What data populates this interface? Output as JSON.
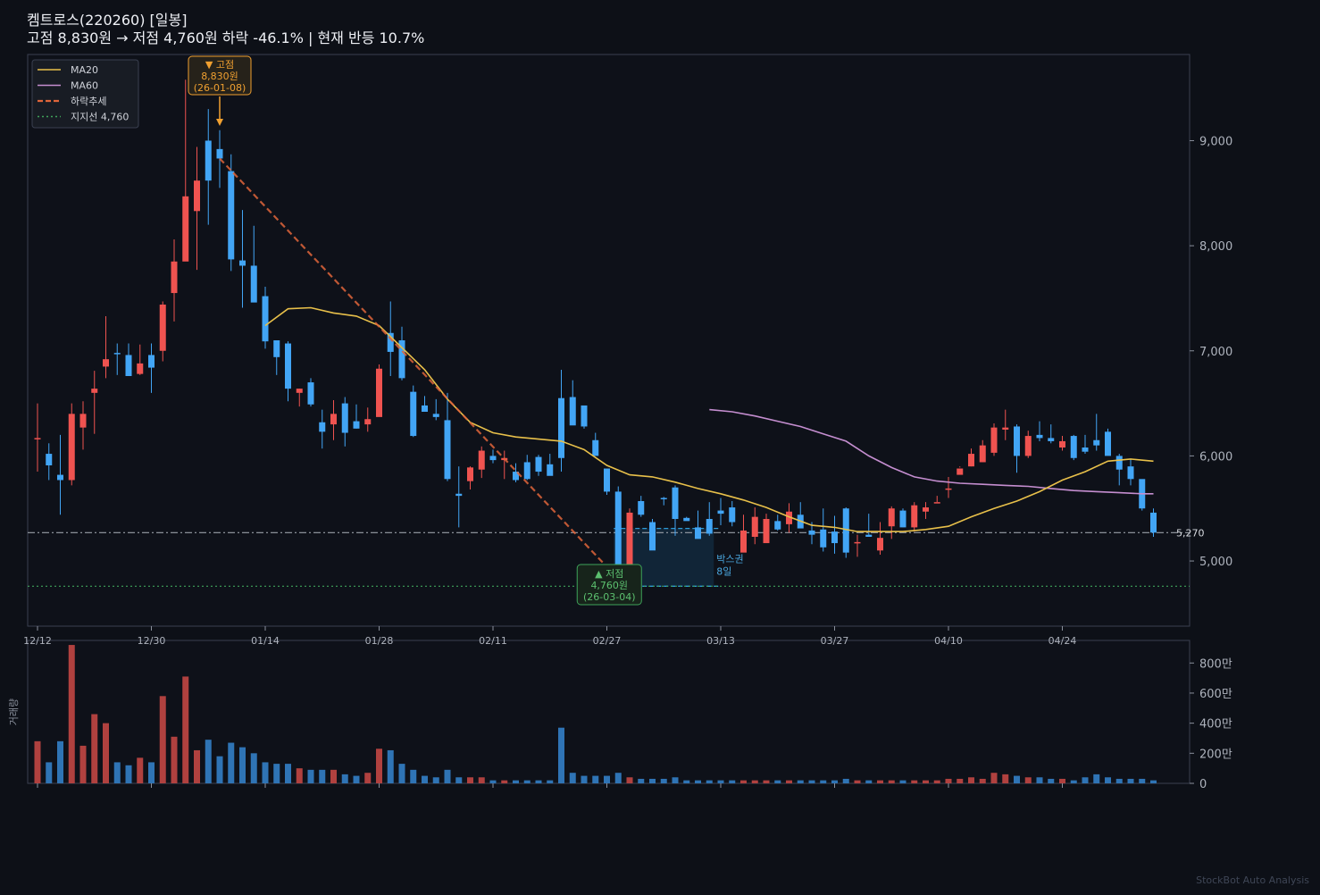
{
  "chart_data": {
    "type": "candlestick",
    "title": "켐트로스(220260)  [일봉]",
    "subtitle": "고점 8,830원 → 저점 4,760원  하락 -46.1%  |  현재 반등 10.7%",
    "x_ticks": [
      "12/12",
      "12/30",
      "01/14",
      "01/28",
      "02/11",
      "02/27",
      "03/13",
      "03/27",
      "04/10",
      "04/24"
    ],
    "price_ticks": [
      "5,000",
      "6,000",
      "7,000",
      "8,000",
      "9,000"
    ],
    "price_tick_values": [
      5000,
      6000,
      7000,
      8000,
      9000
    ],
    "volume_ticks": [
      "0",
      "200만",
      "400만",
      "600만",
      "800만"
    ],
    "volume_tick_values": [
      0,
      200,
      400,
      600,
      800
    ],
    "ylabel_volume": "거래량",
    "price_range": [
      4380,
      9820
    ],
    "volume_range": [
      0,
      950
    ],
    "legend": {
      "placement": "top-left",
      "items": [
        {
          "label": "MA20",
          "color": "#e8c04a",
          "style": "solid"
        },
        {
          "label": "MA60",
          "color": "#c58ed0",
          "style": "solid"
        },
        {
          "label": "하락추세",
          "color": "#e0653a",
          "style": "dashed"
        },
        {
          "label": "지지선 4,760",
          "color": "#3fa35a",
          "style": "dotted"
        }
      ]
    },
    "candles": [
      [
        6170,
        6500,
        5850,
        6170,
        280
      ],
      [
        6020,
        6120,
        5770,
        5910,
        140
      ],
      [
        5820,
        6200,
        5440,
        5770,
        280
      ],
      [
        5770,
        6500,
        5720,
        6400,
        920
      ],
      [
        6270,
        6520,
        6060,
        6400,
        250
      ],
      [
        6600,
        6810,
        6210,
        6640,
        460
      ],
      [
        6850,
        7330,
        6740,
        6920,
        400
      ],
      [
        6980,
        7070,
        6770,
        6970,
        140
      ],
      [
        6960,
        7070,
        6770,
        6760,
        120
      ],
      [
        6780,
        7060,
        6770,
        6880,
        170
      ],
      [
        6960,
        7070,
        6600,
        6840,
        140
      ],
      [
        7000,
        7470,
        6900,
        7440,
        580
      ],
      [
        7550,
        8060,
        7280,
        7850,
        310
      ],
      [
        7850,
        9580,
        8140,
        8470,
        710
      ],
      [
        8330,
        8940,
        7770,
        8620,
        220
      ],
      [
        9000,
        9300,
        8200,
        8620,
        290
      ],
      [
        8920,
        9100,
        8550,
        8830,
        180
      ],
      [
        8710,
        8870,
        7760,
        7870,
        270
      ],
      [
        7860,
        8340,
        7410,
        7810,
        240
      ],
      [
        7810,
        8190,
        7480,
        7460,
        200
      ],
      [
        7520,
        7610,
        7020,
        7090,
        140
      ],
      [
        7100,
        7090,
        6770,
        6940,
        130
      ],
      [
        7070,
        7090,
        6520,
        6640,
        130
      ],
      [
        6600,
        6640,
        6470,
        6640,
        100
      ],
      [
        6700,
        6740,
        6470,
        6490,
        90
      ],
      [
        6320,
        6440,
        6070,
        6230,
        90
      ],
      [
        6300,
        6530,
        6150,
        6400,
        90
      ],
      [
        6500,
        6560,
        6090,
        6220,
        60
      ],
      [
        6330,
        6490,
        6260,
        6260,
        50
      ],
      [
        6300,
        6460,
        6230,
        6350,
        70
      ],
      [
        6370,
        6870,
        6440,
        6830,
        230
      ],
      [
        7170,
        7470,
        6760,
        6990,
        220
      ],
      [
        7100,
        7230,
        6720,
        6740,
        130
      ],
      [
        6610,
        6670,
        6180,
        6190,
        90
      ],
      [
        6480,
        6570,
        6420,
        6420,
        50
      ],
      [
        6400,
        6540,
        6340,
        6370,
        40
      ],
      [
        6340,
        6600,
        5760,
        5780,
        90
      ],
      [
        5640,
        5900,
        5320,
        5620,
        40
      ],
      [
        5760,
        5900,
        5680,
        5890,
        40
      ],
      [
        5870,
        6090,
        5790,
        6050,
        40
      ],
      [
        6000,
        6060,
        5930,
        5960,
        20
      ],
      [
        5960,
        6050,
        5780,
        5980,
        20
      ],
      [
        5850,
        5930,
        5750,
        5770,
        20
      ],
      [
        5940,
        6010,
        5770,
        5780,
        20
      ],
      [
        5990,
        6010,
        5810,
        5850,
        20
      ],
      [
        5920,
        6020,
        5840,
        5810,
        20
      ],
      [
        6550,
        6820,
        5850,
        5980,
        370
      ],
      [
        6560,
        6720,
        6310,
        6290,
        70
      ],
      [
        6480,
        6430,
        6260,
        6280,
        50
      ],
      [
        6150,
        6220,
        6000,
        6000,
        50
      ],
      [
        5880,
        5840,
        5630,
        5660,
        50
      ],
      [
        5660,
        5710,
        5220,
        4760,
        70
      ],
      [
        4900,
        5500,
        4880,
        5460,
        40
      ],
      [
        5570,
        5620,
        5420,
        5440,
        30
      ],
      [
        5370,
        5400,
        5240,
        5100,
        30
      ],
      [
        5600,
        5610,
        5530,
        5590,
        30
      ],
      [
        5700,
        5720,
        5240,
        5400,
        40
      ],
      [
        5410,
        5420,
        5400,
        5380,
        20
      ],
      [
        5320,
        5480,
        5240,
        5210,
        20
      ],
      [
        5400,
        5560,
        5240,
        5260,
        20
      ],
      [
        5480,
        5600,
        5340,
        5450,
        20
      ],
      [
        5510,
        5570,
        5330,
        5370,
        20
      ],
      [
        5080,
        5440,
        5100,
        5290,
        20
      ],
      [
        5230,
        5510,
        5160,
        5420,
        20
      ],
      [
        5170,
        5450,
        5210,
        5400,
        20
      ],
      [
        5380,
        5440,
        5290,
        5300,
        20
      ],
      [
        5350,
        5550,
        5270,
        5470,
        20
      ],
      [
        5440,
        5560,
        5320,
        5310,
        20
      ],
      [
        5290,
        5370,
        5160,
        5250,
        20
      ],
      [
        5300,
        5500,
        5090,
        5130,
        20
      ],
      [
        5280,
        5430,
        5070,
        5170,
        20
      ],
      [
        5500,
        5510,
        5030,
        5080,
        30
      ],
      [
        5180,
        5250,
        5040,
        5180,
        20
      ],
      [
        5250,
        5450,
        5250,
        5230,
        20
      ],
      [
        5100,
        5370,
        5060,
        5220,
        20
      ],
      [
        5330,
        5520,
        5210,
        5500,
        20
      ],
      [
        5480,
        5500,
        5320,
        5320,
        20
      ],
      [
        5320,
        5560,
        5280,
        5530,
        20
      ],
      [
        5470,
        5560,
        5400,
        5510,
        20
      ],
      [
        5560,
        5620,
        5560,
        5560,
        20
      ],
      [
        5690,
        5800,
        5600,
        5690,
        30
      ],
      [
        5820,
        5900,
        5890,
        5880,
        30
      ],
      [
        5900,
        6070,
        5900,
        6020,
        40
      ],
      [
        5940,
        6150,
        5940,
        6100,
        30
      ],
      [
        6030,
        6310,
        6000,
        6270,
        70
      ],
      [
        6250,
        6440,
        6150,
        6270,
        60
      ],
      [
        6280,
        6300,
        5840,
        6000,
        50
      ],
      [
        6000,
        6240,
        5980,
        6190,
        40
      ],
      [
        6200,
        6330,
        6140,
        6170,
        40
      ],
      [
        6170,
        6300,
        6120,
        6140,
        30
      ],
      [
        6080,
        6190,
        6050,
        6140,
        30
      ],
      [
        6190,
        6200,
        5960,
        5980,
        20
      ],
      [
        6080,
        6200,
        6020,
        6040,
        40
      ],
      [
        6150,
        6400,
        6050,
        6100,
        60
      ],
      [
        6230,
        6260,
        6050,
        6000,
        40
      ],
      [
        6000,
        6020,
        5720,
        5870,
        30
      ],
      [
        5900,
        5970,
        5720,
        5780,
        30
      ],
      [
        5780,
        5760,
        5480,
        5500,
        30
      ],
      [
        5460,
        5500,
        5230,
        5270,
        20
      ]
    ],
    "ma20": [
      [
        20,
        7240
      ],
      [
        22,
        7400
      ],
      [
        24,
        7410
      ],
      [
        26,
        7360
      ],
      [
        28,
        7330
      ],
      [
        30,
        7240
      ],
      [
        32,
        7030
      ],
      [
        34,
        6820
      ],
      [
        36,
        6540
      ],
      [
        38,
        6320
      ],
      [
        40,
        6220
      ],
      [
        42,
        6180
      ],
      [
        44,
        6160
      ],
      [
        46,
        6140
      ],
      [
        48,
        6060
      ],
      [
        50,
        5910
      ],
      [
        52,
        5820
      ],
      [
        54,
        5800
      ],
      [
        56,
        5750
      ],
      [
        58,
        5690
      ],
      [
        60,
        5640
      ],
      [
        62,
        5580
      ],
      [
        64,
        5510
      ],
      [
        66,
        5420
      ],
      [
        68,
        5340
      ],
      [
        70,
        5320
      ],
      [
        72,
        5280
      ],
      [
        74,
        5280
      ],
      [
        76,
        5280
      ],
      [
        78,
        5300
      ],
      [
        80,
        5330
      ],
      [
        82,
        5420
      ],
      [
        84,
        5500
      ],
      [
        86,
        5570
      ],
      [
        88,
        5660
      ],
      [
        90,
        5770
      ],
      [
        92,
        5850
      ],
      [
        94,
        5950
      ],
      [
        96,
        5970
      ],
      [
        98,
        5950
      ]
    ],
    "ma60": [
      [
        59,
        6440
      ],
      [
        61,
        6420
      ],
      [
        63,
        6380
      ],
      [
        65,
        6330
      ],
      [
        67,
        6280
      ],
      [
        69,
        6210
      ],
      [
        71,
        6140
      ],
      [
        73,
        6000
      ],
      [
        75,
        5890
      ],
      [
        77,
        5800
      ],
      [
        79,
        5760
      ],
      [
        81,
        5740
      ],
      [
        83,
        5730
      ],
      [
        85,
        5720
      ],
      [
        87,
        5710
      ],
      [
        89,
        5690
      ],
      [
        91,
        5670
      ],
      [
        93,
        5660
      ],
      [
        95,
        5650
      ],
      [
        97,
        5640
      ],
      [
        98,
        5640
      ]
    ],
    "trend_line": {
      "from": [
        16,
        8830
      ],
      "to": [
        51,
        4830
      ]
    },
    "support_line": {
      "label": "지지선 4,760",
      "value": 4760
    },
    "current_line": {
      "label": "5,270",
      "value": 5270
    },
    "peak": {
      "index": 16,
      "arrow": "▼ 고점",
      "price": "8,830원",
      "date": "(26-01-08)"
    },
    "trough": {
      "index": 51,
      "arrow": "▲ 저점",
      "price": "4,760원",
      "date": "(26-03-04)"
    },
    "box_zone": {
      "from": 51,
      "to": 59,
      "low": 4760,
      "high": 5310,
      "label1": "박스권",
      "label2": "8일"
    }
  },
  "watermark": "StockBot Auto Analysis",
  "colors": {
    "up": "#ef5350",
    "down": "#42a5f5",
    "background": "#0d1017",
    "axes_border": "#3a4050",
    "peak_label": "#f0a030",
    "trough_label": "#3fa35a",
    "box": "#1f6fa6"
  }
}
